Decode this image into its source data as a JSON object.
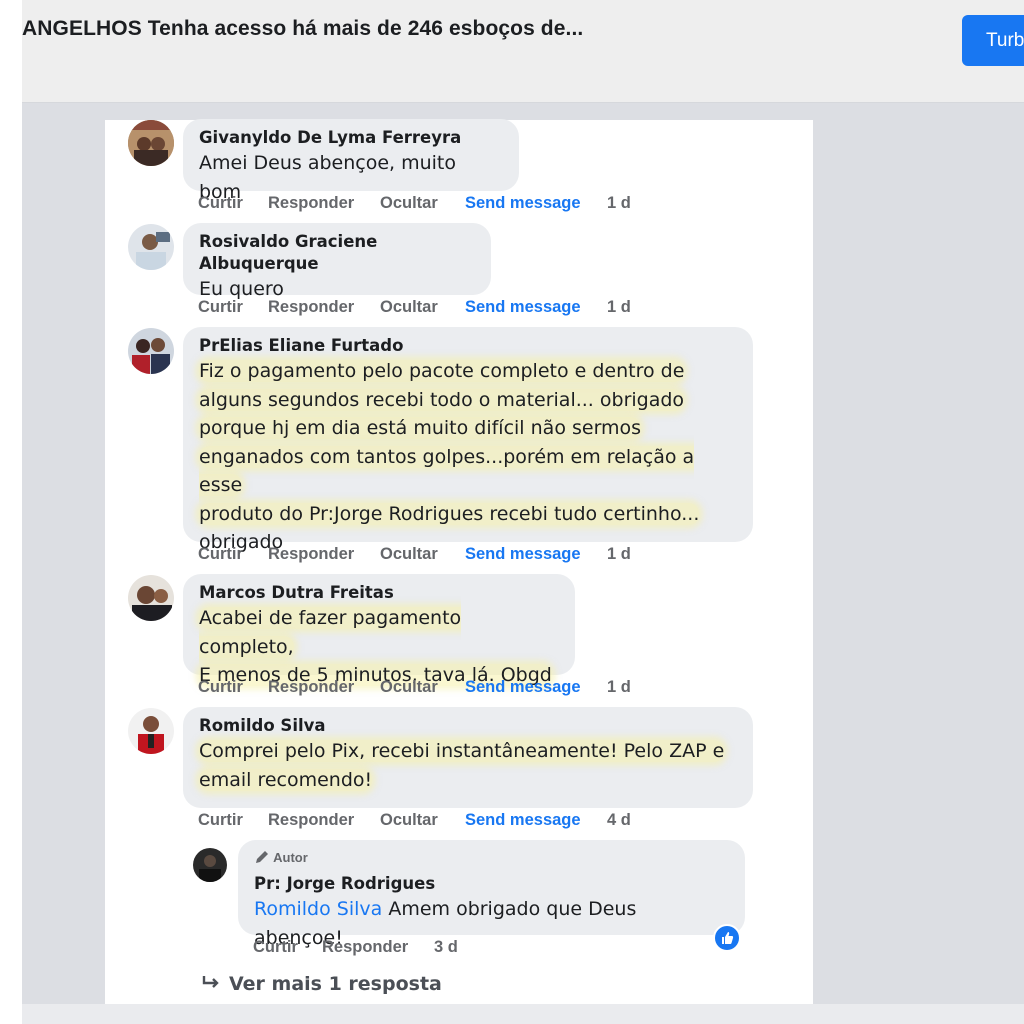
{
  "header": {
    "title": "ANGELHOS Tenha acesso há mais de 246 esboços de...",
    "button_label": "Turb"
  },
  "colors": {
    "accent": "#1877f2",
    "bubble": "#ebedf0",
    "action": "#65676b"
  },
  "actions": {
    "like": "Curtir",
    "reply": "Responder",
    "hide": "Ocultar",
    "send": "Send message"
  },
  "comments": [
    {
      "author": "Givanyldo De Lyma Ferreyra",
      "lines": [
        "Amei Deus abençoe, muito bom"
      ],
      "time": "1 d"
    },
    {
      "author": "Rosivaldo Graciene Albuquerque",
      "lines": [
        "Eu quero"
      ],
      "time": "1 d"
    },
    {
      "author": "PrElias Eliane Furtado",
      "lines": [
        "Fiz o pagamento pelo pacote completo e dentro de",
        "alguns segundos recebi todo o material... obrigado",
        "porque hj em dia está muito difícil não sermos",
        "enganados com tantos golpes...porém em relação a esse",
        "produto do Pr:Jorge Rodrigues recebi tudo certinho...",
        "obrigado"
      ],
      "time": "1 d"
    },
    {
      "author": "Marcos Dutra Freitas",
      "lines": [
        "Acabei de fazer pagamento completo,",
        "E menos de 5 minutos, tava lá. Obgd"
      ],
      "time": "1 d"
    },
    {
      "author": "Romildo Silva",
      "lines": [
        "Comprei pelo Pix, recebi instantâneamente! Pelo ZAP e",
        "email recomendo!"
      ],
      "time": "4 d"
    }
  ],
  "reply": {
    "badge": "Autor",
    "author": "Pr: Jorge Rodrigues",
    "mention": "Romildo Silva",
    "text": " Amem obrigado que Deus abençoe!",
    "like": "Curtir",
    "reply_label": "Responder",
    "time": "3 d"
  },
  "more_replies": "Ver mais 1 resposta"
}
